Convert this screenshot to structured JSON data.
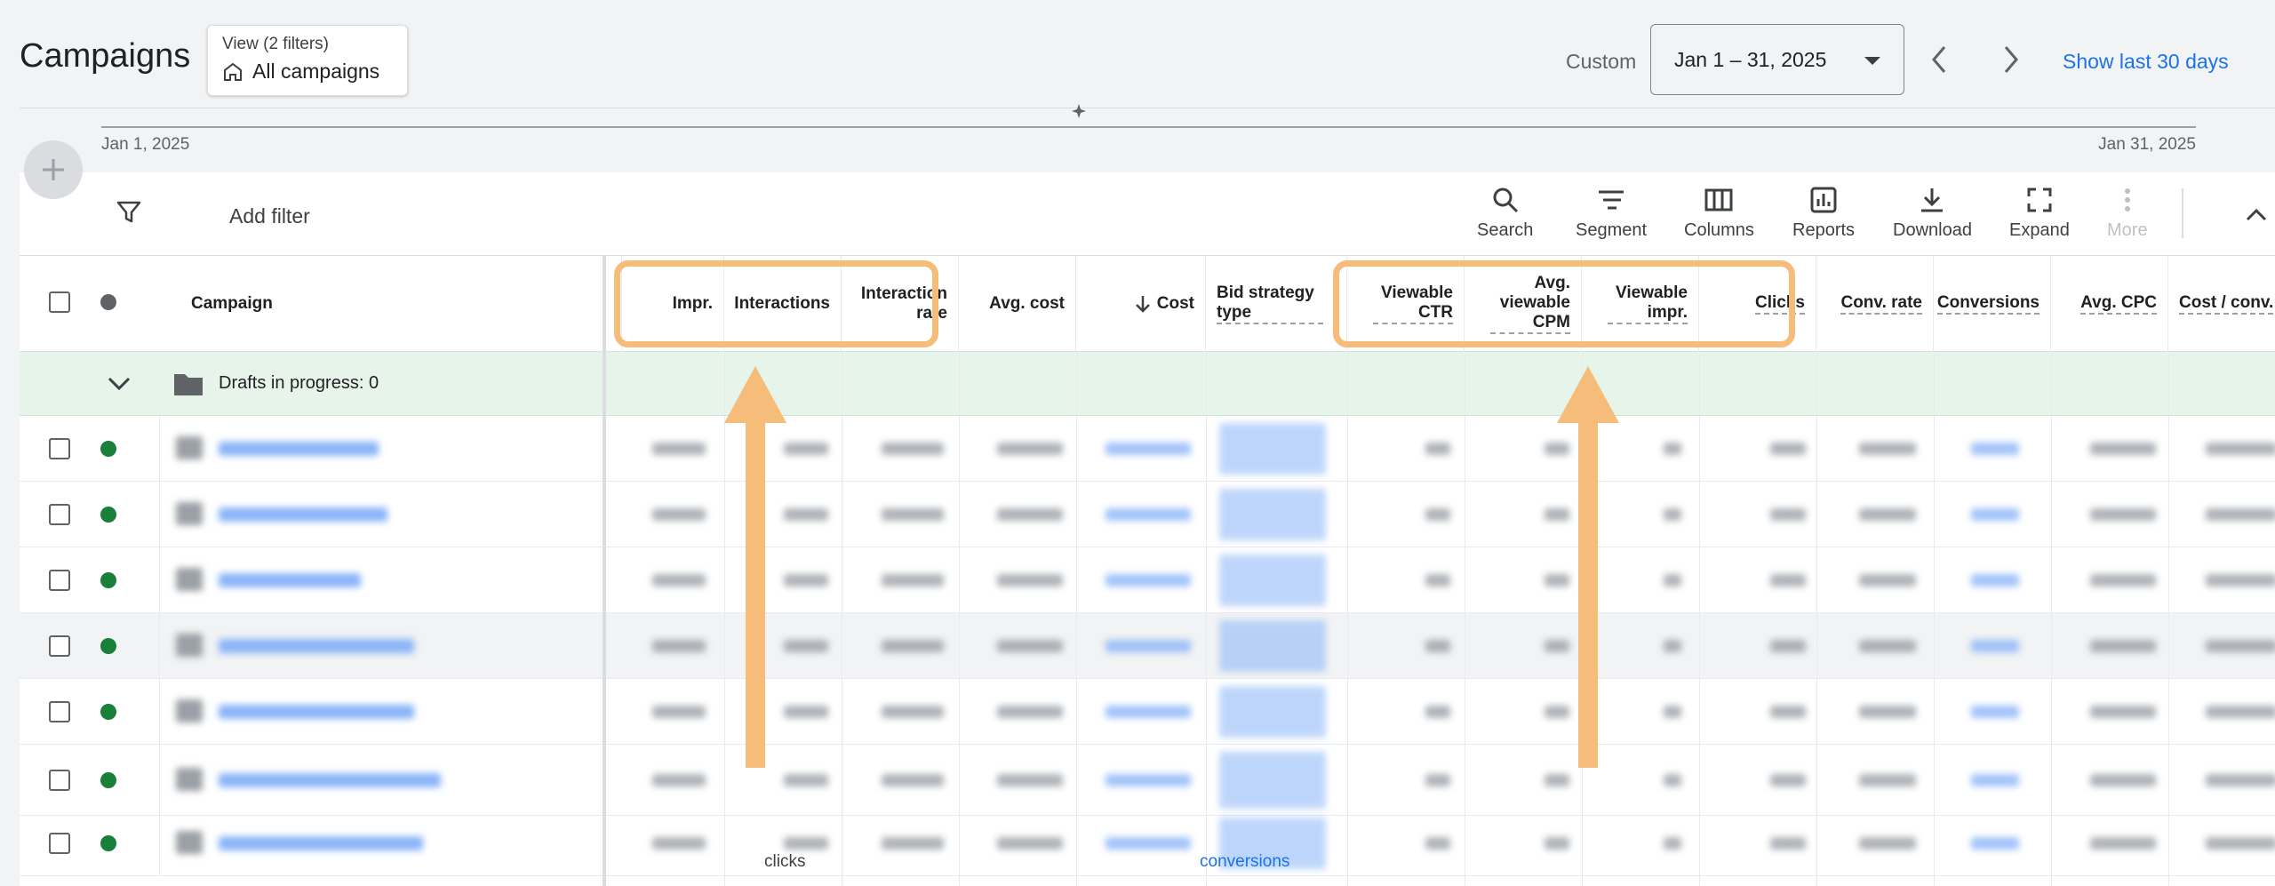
{
  "page": {
    "title": "Campaigns"
  },
  "view": {
    "sub_label": "View (2 filters)",
    "value": "All campaigns"
  },
  "date": {
    "custom_label": "Custom",
    "range": "Jan 1 – 31, 2025",
    "show_last_30": "Show last 30 days"
  },
  "timeline": {
    "start": "Jan 1, 2025",
    "end": "Jan 31, 2025"
  },
  "filter": {
    "add_label": "Add filter"
  },
  "toolbar": {
    "search": "Search",
    "segment": "Segment",
    "columns": "Columns",
    "reports": "Reports",
    "download": "Download",
    "expand": "Expand",
    "more": "More"
  },
  "table": {
    "headers": {
      "campaign": "Campaign",
      "impr": "Impr.",
      "interactions": "Interactions",
      "interaction_rate": "Interaction rate",
      "avg_cost": "Avg. cost",
      "cost": "Cost",
      "bid_strategy_type": "Bid strategy type",
      "viewable_ctr": "Viewable CTR",
      "avg_viewable_cpm": "Avg. viewable CPM",
      "viewable_impr": "Viewable impr.",
      "clicks": "Clicks",
      "conv_rate": "Conv. rate",
      "conversions": "Conversions",
      "avg_cpc": "Avg. CPC",
      "cost_per_conv": "Cost / conv."
    },
    "drafts": "Drafts in progress: 0",
    "bottom_clip": {
      "interactions_unit": "clicks",
      "bid_strategy": "conversions"
    }
  },
  "colors": {
    "accent": "#1a73e8",
    "highlight": "#f6bd7a",
    "status_enabled": "#188038",
    "drafts_bg": "#e6f4ea"
  }
}
